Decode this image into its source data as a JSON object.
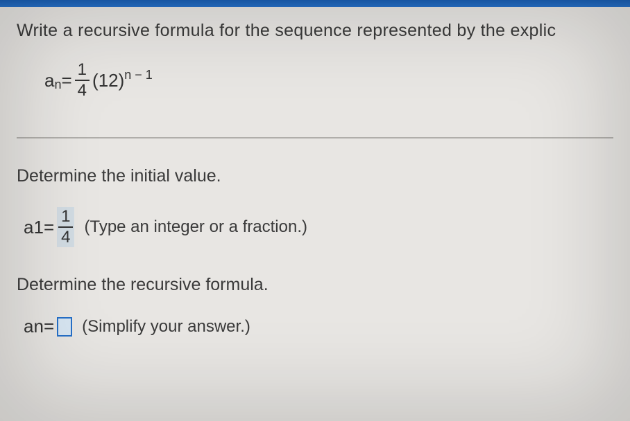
{
  "question": {
    "prompt": "Write a recursive formula for the sequence represented by the explic",
    "formula": {
      "lhs_var": "a",
      "lhs_sub": "n",
      "equals": " = ",
      "frac_num": "1",
      "frac_den": "4",
      "base": "(12)",
      "exp": "n − 1"
    }
  },
  "section1": {
    "heading": "Determine the initial value.",
    "answer": {
      "lhs_var": "a",
      "lhs_sub": "1",
      "equals": " = ",
      "frac_num": "1",
      "frac_den": "4"
    },
    "hint": "(Type an integer or a fraction.)"
  },
  "section2": {
    "heading": "Determine the recursive formula.",
    "answer": {
      "lhs_var": "a",
      "lhs_sub": "n",
      "equals": " = "
    },
    "hint": "(Simplify your answer.)"
  }
}
